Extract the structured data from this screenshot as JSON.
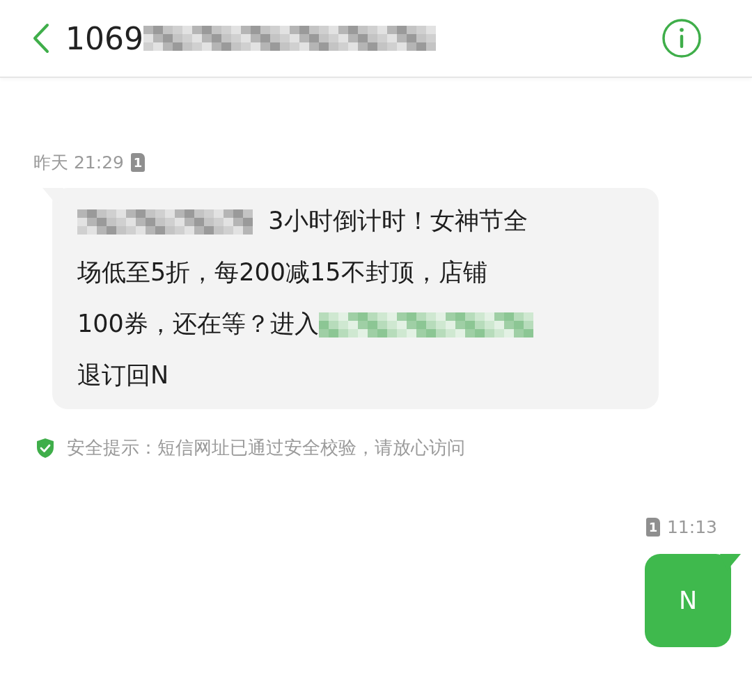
{
  "header": {
    "title": "1069"
  },
  "messages": [
    {
      "kind": "incoming",
      "time": "昨天 21:29",
      "sim": "1",
      "parts": [
        {
          "kind": "blur"
        },
        {
          "kind": "text",
          "text": "3小时倒计时！女神节全"
        },
        {
          "kind": "break"
        },
        {
          "kind": "text",
          "text": "场低至5折，每200减15不封顶，店铺"
        },
        {
          "kind": "break"
        },
        {
          "kind": "text",
          "text": "100券，还在等？进入"
        },
        {
          "kind": "blurlink"
        },
        {
          "kind": "break"
        },
        {
          "kind": "text",
          "text": "退订回N"
        }
      ],
      "notice": "安全提示：短信网址已通过安全校验，请放心访问"
    },
    {
      "kind": "outgoing",
      "time": "11:13",
      "sim": "1",
      "parts": [
        {
          "kind": "text",
          "text": "N"
        }
      ]
    }
  ]
}
